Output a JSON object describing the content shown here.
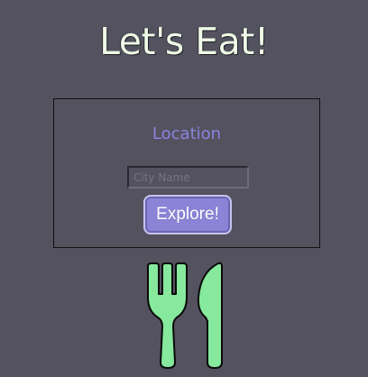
{
  "header": {
    "title": "Let's Eat!"
  },
  "search": {
    "label": "Location",
    "placeholder": "City Name",
    "value": "",
    "button_label": "Explore!"
  },
  "icons": {
    "decoration": "fork-and-knife-icon"
  },
  "colors": {
    "background": "#54525f",
    "title": "#effbe7",
    "accent": "#8b83d6",
    "label": "#8c83de",
    "utensils": "#86e99d"
  }
}
